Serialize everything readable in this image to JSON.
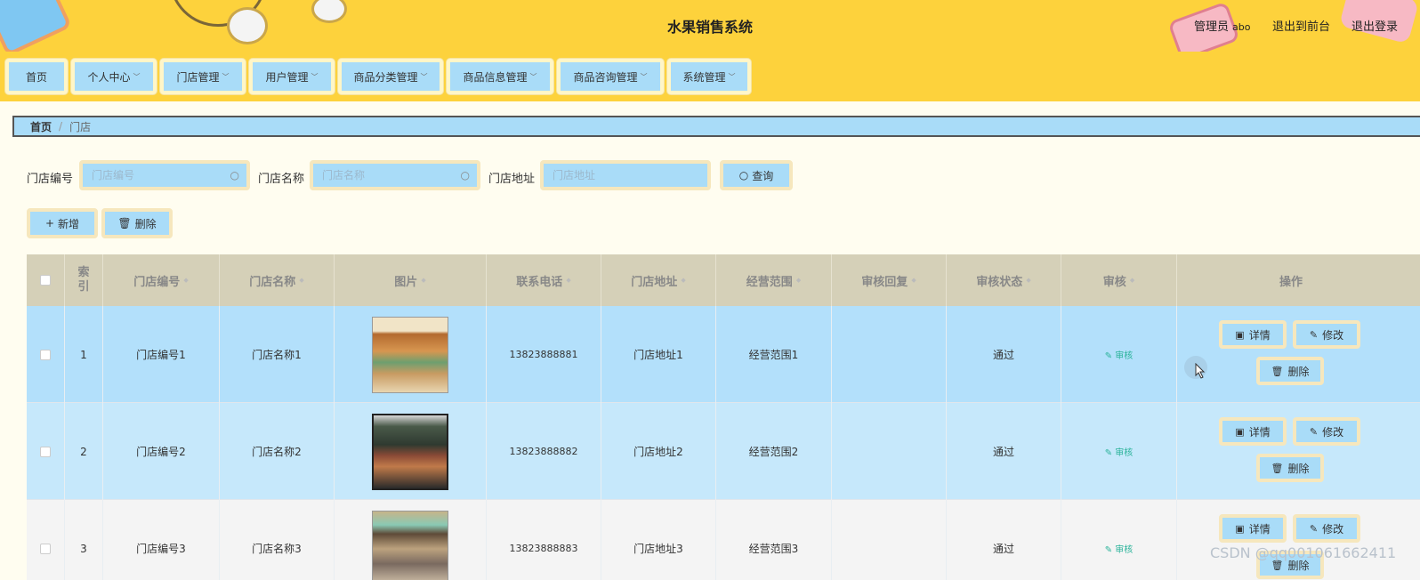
{
  "header": {
    "title": "水果销售系统",
    "role_label": "管理员",
    "username": "abo",
    "front_link": "退出到前台",
    "logout_link": "退出登录"
  },
  "nav": {
    "items": [
      {
        "label": "首页",
        "has_dropdown": false
      },
      {
        "label": "个人中心",
        "has_dropdown": true
      },
      {
        "label": "门店管理",
        "has_dropdown": true
      },
      {
        "label": "用户管理",
        "has_dropdown": true
      },
      {
        "label": "商品分类管理",
        "has_dropdown": true
      },
      {
        "label": "商品信息管理",
        "has_dropdown": true
      },
      {
        "label": "商品咨询管理",
        "has_dropdown": true
      },
      {
        "label": "系统管理",
        "has_dropdown": true
      }
    ]
  },
  "breadcrumb": {
    "home": "首页",
    "separator": "/",
    "current": "门店"
  },
  "search": {
    "fields": [
      {
        "label": "门店编号",
        "placeholder": "门店编号",
        "value": ""
      },
      {
        "label": "门店名称",
        "placeholder": "门店名称",
        "value": ""
      },
      {
        "label": "门店地址",
        "placeholder": "门店地址",
        "value": ""
      }
    ],
    "query_button": "查询"
  },
  "actions": {
    "add_button": "新增",
    "delete_button": "删除"
  },
  "table": {
    "columns": [
      "索引",
      "门店编号",
      "门店名称",
      "图片",
      "联系电话",
      "门店地址",
      "经营范围",
      "审核回复",
      "审核状态",
      "审核",
      "操作"
    ],
    "rows": [
      {
        "index": "1",
        "code": "门店编号1",
        "name": "门店名称1",
        "image": "store-photo-1",
        "phone": "13823888881",
        "address": "门店地址1",
        "scope": "经营范围1",
        "reply": "",
        "status": "通过",
        "approve": "审核"
      },
      {
        "index": "2",
        "code": "门店编号2",
        "name": "门店名称2",
        "image": "store-photo-2",
        "phone": "13823888882",
        "address": "门店地址2",
        "scope": "经营范围2",
        "reply": "",
        "status": "通过",
        "approve": "审核"
      },
      {
        "index": "3",
        "code": "门店编号3",
        "name": "门店名称3",
        "image": "store-photo-3",
        "phone": "13823888883",
        "address": "门店地址3",
        "scope": "经营范围3",
        "reply": "",
        "status": "通过",
        "approve": "审核"
      }
    ],
    "row_actions": {
      "detail": "详情",
      "edit": "修改",
      "delete": "删除"
    }
  },
  "watermark": "CSDN @qq001061662411",
  "colors": {
    "header_bg": "#fdd23c",
    "button_bg": "#a9dcf8",
    "row_selected": "#b3e0fb",
    "row_alt": "#c6e8fb",
    "approve_link": "#2bb39a"
  }
}
